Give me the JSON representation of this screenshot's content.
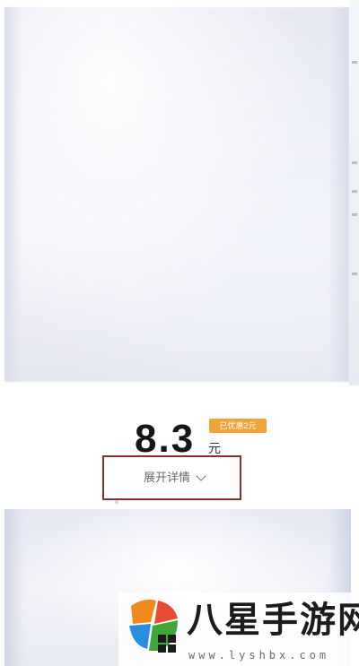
{
  "price": {
    "value": "8.3",
    "unit": "元",
    "discount_badge": "已优惠2元"
  },
  "details": {
    "expand_label": "展开详情",
    "expand_icon": "chevron-down-icon"
  },
  "watermark": {
    "title": "八星手游网",
    "url": "www.lyshbx.com"
  },
  "colors": {
    "badge": "#f1a43a",
    "highlight_border": "#8b2e2e",
    "price_text": "#151515"
  }
}
